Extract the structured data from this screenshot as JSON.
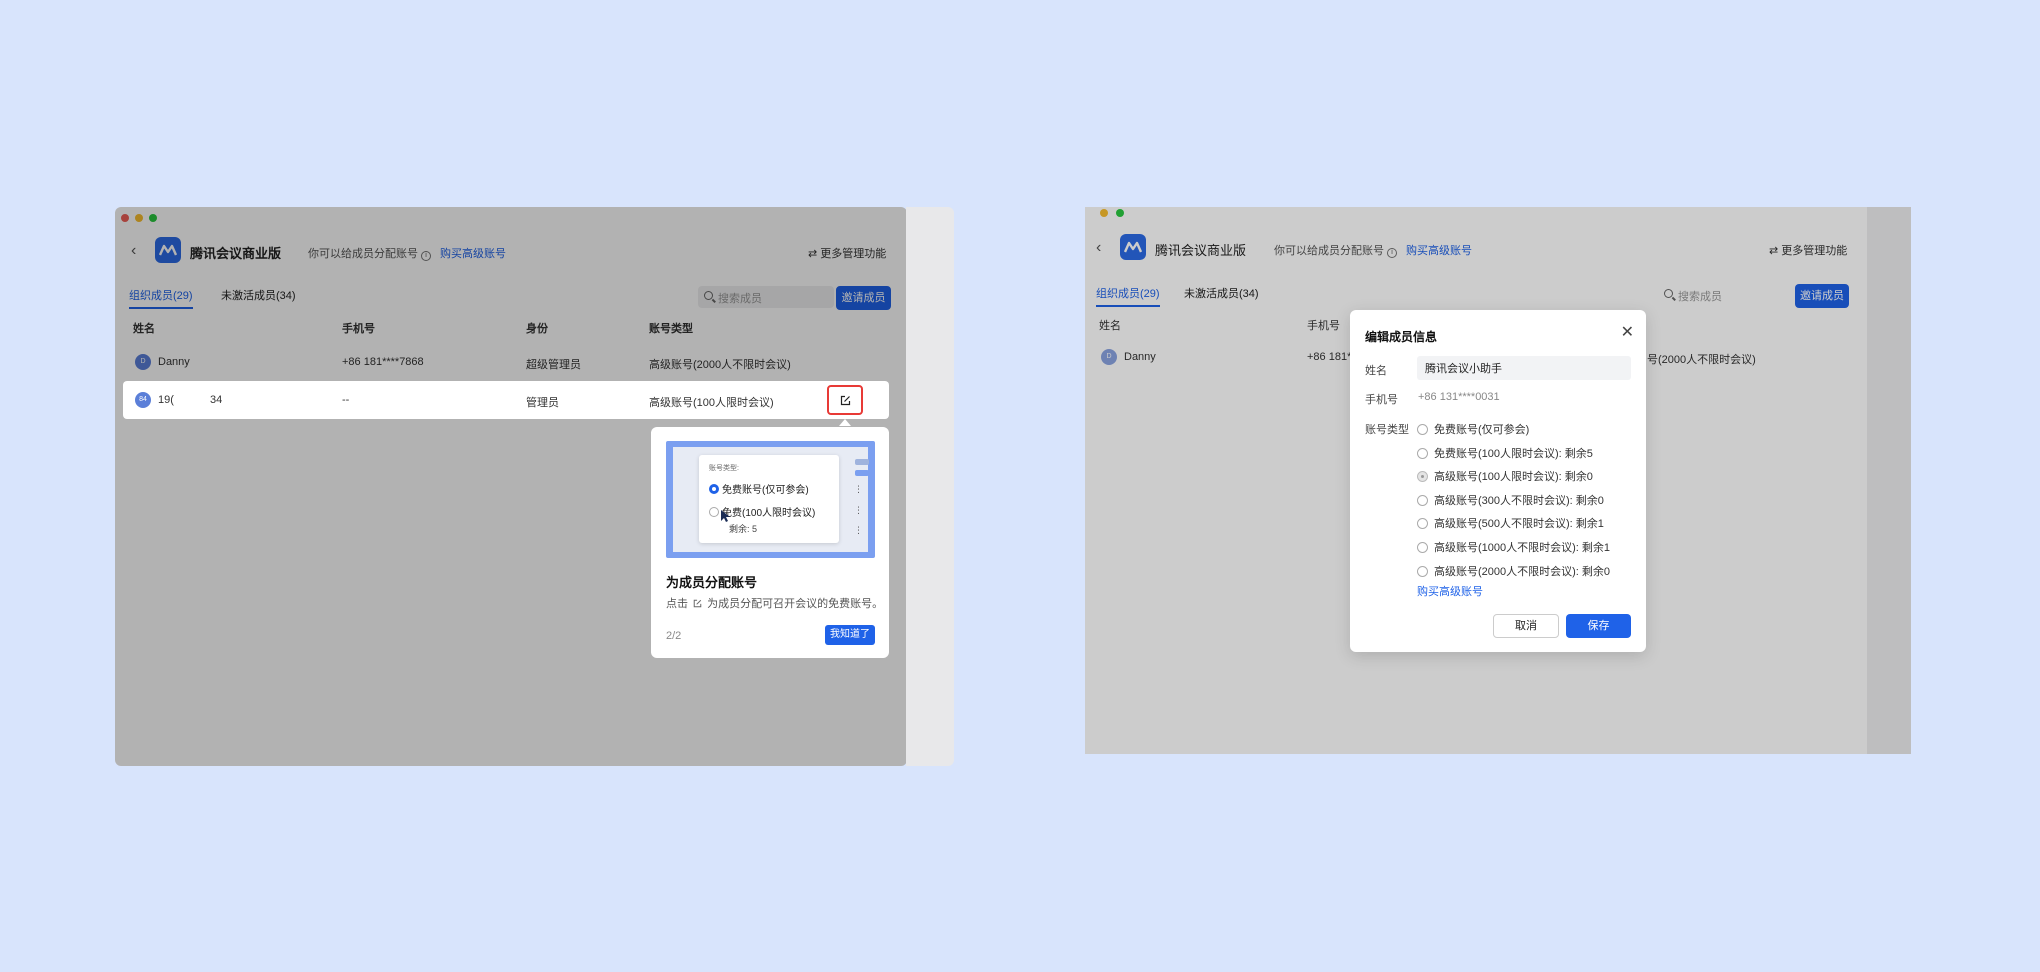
{
  "left": {
    "app_title": "腾讯会议商业版",
    "hint": "你可以给成员分配账号",
    "buy_link": "购买高级账号",
    "more_mgmt": "更多管理功能",
    "tabs": [
      "组织成员(29)",
      "未激活成员(34)"
    ],
    "search_placeholder": "搜索成员",
    "invite": "邀请成员",
    "columns": [
      "姓名",
      "手机号",
      "身份",
      "账号类型"
    ],
    "rows": [
      {
        "avatar": "D",
        "name": "Danny",
        "phone": "+86 181****7868",
        "role": "超级管理员",
        "account": "高级账号(2000人不限时会议)"
      },
      {
        "avatar": "84",
        "name": "19(",
        "name_tail": "34",
        "phone": "--",
        "role": "管理员",
        "account": "高级账号(100人限时会议)"
      }
    ],
    "popover": {
      "illus_title": "账号类型:",
      "illus_opt1": "免费账号(仅可参会)",
      "illus_opt2": "免费(100人限时会议)",
      "illus_remain": "剩余: 5",
      "title": "为成员分配账号",
      "desc_prefix": "点击",
      "desc_suffix": "为成员分配可召开会议的免费账号。",
      "pager": "2/2",
      "ok": "我知道了"
    }
  },
  "right": {
    "app_title": "腾讯会议商业版",
    "hint": "你可以给成员分配账号",
    "buy_link": "购买高级账号",
    "more_mgmt": "更多管理功能",
    "tabs": [
      "组织成员(29)",
      "未激活成员(34)"
    ],
    "search_placeholder": "搜索成员",
    "invite": "邀请成员",
    "columns": [
      "姓名",
      "手机号"
    ],
    "row": {
      "avatar": "D",
      "name": "Danny",
      "phone_partial": "+86 181*",
      "account_partial": "号(2000人不限时会议)"
    },
    "dialog": {
      "title": "编辑成员信息",
      "name_label": "姓名",
      "name_value": "腾讯会议小助手",
      "phone_label": "手机号",
      "phone_value": "+86 131****0031",
      "type_label": "账号类型",
      "options": [
        "免费账号(仅可参会)",
        "免费账号(100人限时会议): 剩余5",
        "高级账号(100人限时会议): 剩余0",
        "高级账号(300人不限时会议): 剩余0",
        "高级账号(500人不限时会议): 剩余1",
        "高级账号(1000人不限时会议): 剩余1",
        "高级账号(2000人不限时会议): 剩余0"
      ],
      "selected_index": 2,
      "buy_link": "购买高级账号",
      "cancel": "取消",
      "save": "保存"
    }
  },
  "colors": {
    "background": "#d8e4fc",
    "accent": "#1f62e8",
    "highlight_border": "#e83a36"
  }
}
